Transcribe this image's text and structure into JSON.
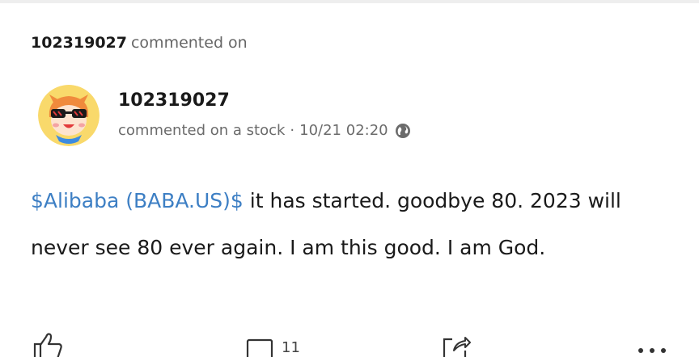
{
  "activity": {
    "user": "102319027",
    "action": "commented on"
  },
  "post": {
    "author": "102319027",
    "meta_action": "commented on a stock",
    "separator": "·",
    "timestamp": "10/21 02:20",
    "visibility_icon": "globe-icon",
    "ticker": "$Alibaba (BABA.US)$",
    "body_text": " it has started. goodbye 80. 2023 will never see 80 ever again. I am this good. I am God."
  },
  "actions": {
    "like_icon": "thumbs-up-icon",
    "comment_icon": "comment-icon",
    "comment_count": "11",
    "share_icon": "share-icon",
    "more_icon": "more-icon"
  },
  "colors": {
    "ticker_link": "#3d7fc4",
    "avatar_bg": "#f9d96b",
    "meta_text": "#6b6b6b"
  }
}
